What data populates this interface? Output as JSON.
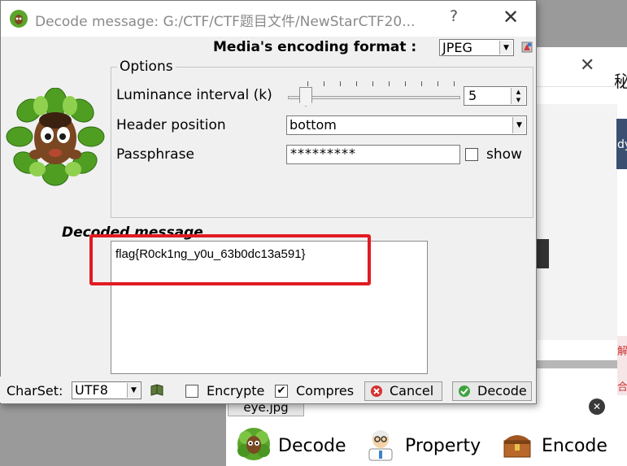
{
  "background_window": {
    "cjk_char": "秘",
    "side_text": "dy",
    "side_marks": [
      "解",
      "合"
    ]
  },
  "dialog": {
    "title": "Decode message: G:/CTF/CTF题目文件/NewStarCTF20...",
    "help": "?",
    "close": "✕"
  },
  "format": {
    "label": "Media's encoding format :",
    "value": "JPEG"
  },
  "options": {
    "legend": "Options",
    "luminance_label": "Luminance interval (k)",
    "luminance_value": "5",
    "header_label": "Header position",
    "header_value": "bottom",
    "passphrase_label": "Passphrase",
    "passphrase_value": "*********",
    "show_label": "show",
    "show_checked": false
  },
  "decoded": {
    "label": "Decoded message",
    "message": "flag{R0ck1ng_y0u_63b0dc13a591}"
  },
  "bottom": {
    "charset_label": "CharSet:",
    "charset_value": "UTF8",
    "encrypted_label": "Encrypte",
    "encrypted_checked": false,
    "compress_label": "Compres",
    "compress_checked": true,
    "cancel_label": "Cancel",
    "decode_label": "Decode"
  },
  "lower_panel": {
    "tab_label": "eye.jpg",
    "decode_label": "Decode",
    "property_label": "Property",
    "encode_label": "Encode"
  },
  "colors": {
    "highlight": "#e11b22",
    "dialog_bg": "#f0f0f0",
    "title_text": "#8a8a8a"
  }
}
